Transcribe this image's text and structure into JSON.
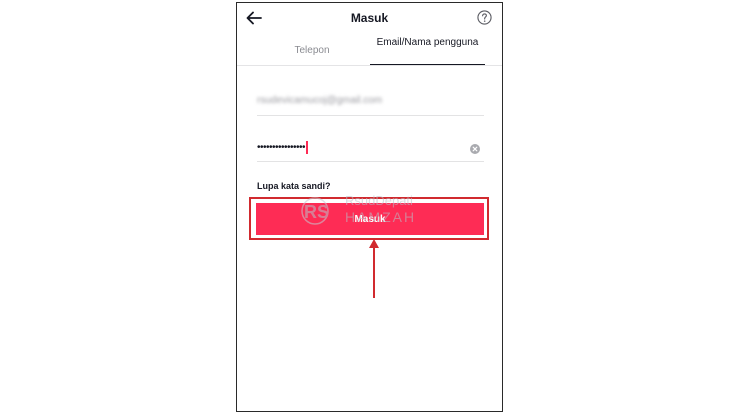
{
  "header": {
    "title": "Masuk",
    "back_icon": "arrow-left-icon",
    "help_icon": "question-circle-icon"
  },
  "tabs": [
    {
      "label": "Telepon",
      "active": false
    },
    {
      "label": "Email/Nama pengguna",
      "active": true
    }
  ],
  "form": {
    "email_value": "rsudevicamucoj@gmail.com",
    "password_masked": "••••••••••••••••",
    "clear_icon": "clear-circle-icon",
    "forgot_label": "Lupa kata sandi?",
    "submit_label": "Masuk"
  },
  "watermark": {
    "line1": "RsudDepati",
    "line2": "HAMZAH"
  },
  "colors": {
    "accent": "#fe2c55",
    "highlight_border": "#d12a2f",
    "arrow": "#d12a2f",
    "text_dark": "#161823",
    "text_muted": "#8a8b91"
  }
}
